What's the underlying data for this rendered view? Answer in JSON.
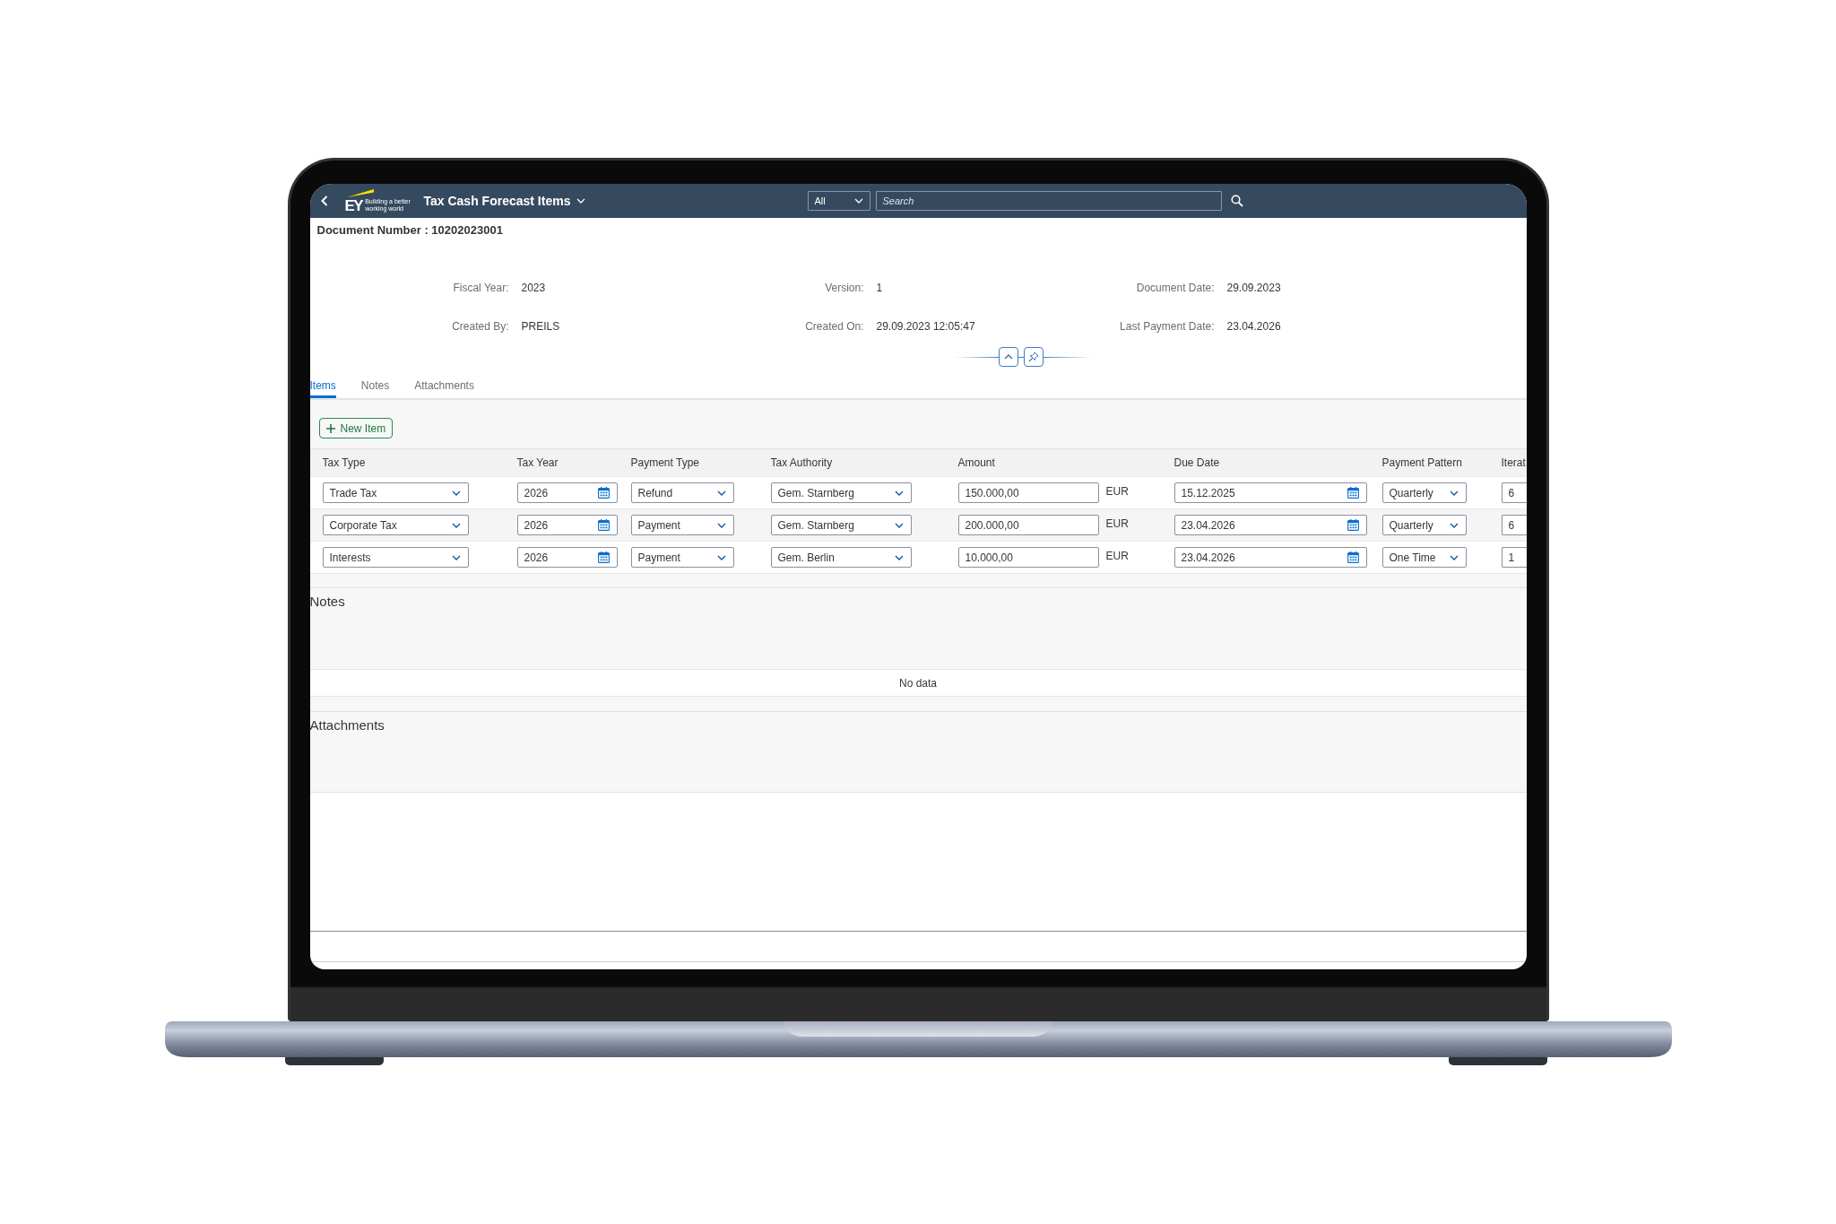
{
  "header": {
    "logo": {
      "mark": "EY",
      "tagline": "Building a better working world"
    },
    "title": "Tax Cash Forecast Items",
    "search_scope": "All",
    "search": {
      "placeholder": "Search"
    }
  },
  "document_number": "Document Number : 10202023001",
  "summary_fields": [
    {
      "label": "Fiscal Year:",
      "value": "2023"
    },
    {
      "label": "Version:",
      "value": "1"
    },
    {
      "label": "Document Date:",
      "value": "29.09.2023"
    },
    {
      "label": "Created By:",
      "value": "PREILS"
    },
    {
      "label": "Created On:",
      "value": "29.09.2023 12:05:47"
    },
    {
      "label": "Last Payment Date:",
      "value": "23.04.2026"
    }
  ],
  "tabs": [
    {
      "label": "Items",
      "selected": true
    },
    {
      "label": "Notes",
      "selected": false
    },
    {
      "label": "Attachments",
      "selected": false
    }
  ],
  "items": {
    "add_button": "New Item",
    "columns": [
      "Tax Type",
      "Tax Year",
      "Payment Type",
      "Tax Authority",
      "Amount",
      "Due Date",
      "Payment Pattern",
      "Iterat"
    ],
    "rows": [
      {
        "cells": [
          {
            "kind": "select",
            "value": "Trade Tax"
          },
          {
            "kind": "date",
            "value": "2026"
          },
          {
            "kind": "select",
            "value": "Refund"
          },
          {
            "kind": "select",
            "value": "Gem. Starnberg"
          },
          {
            "kind": "amount",
            "value": "150.000,00",
            "currency": "EUR"
          },
          {
            "kind": "date",
            "value": "15.12.2025"
          },
          {
            "kind": "select",
            "value": "Quarterly"
          },
          {
            "kind": "text",
            "value": "6"
          }
        ]
      },
      {
        "cells": [
          {
            "kind": "select",
            "value": "Corporate Tax"
          },
          {
            "kind": "date",
            "value": "2026"
          },
          {
            "kind": "select",
            "value": "Payment"
          },
          {
            "kind": "select",
            "value": "Gem. Starnberg"
          },
          {
            "kind": "amount",
            "value": "200.000,00",
            "currency": "EUR"
          },
          {
            "kind": "date",
            "value": "23.04.2026"
          },
          {
            "kind": "select",
            "value": "Quarterly"
          },
          {
            "kind": "text",
            "value": "6"
          }
        ]
      },
      {
        "cells": [
          {
            "kind": "select",
            "value": "Interests"
          },
          {
            "kind": "date",
            "value": "2026"
          },
          {
            "kind": "select",
            "value": "Payment"
          },
          {
            "kind": "select",
            "value": "Gem. Berlin"
          },
          {
            "kind": "amount",
            "value": "10.000,00",
            "currency": "EUR"
          },
          {
            "kind": "date",
            "value": "23.04.2026"
          },
          {
            "kind": "select",
            "value": "One Time"
          },
          {
            "kind": "text",
            "value": "1"
          }
        ]
      }
    ]
  },
  "notes": {
    "title": "Notes",
    "empty_text": "No data"
  },
  "attachments": {
    "title": "Attachments"
  }
}
